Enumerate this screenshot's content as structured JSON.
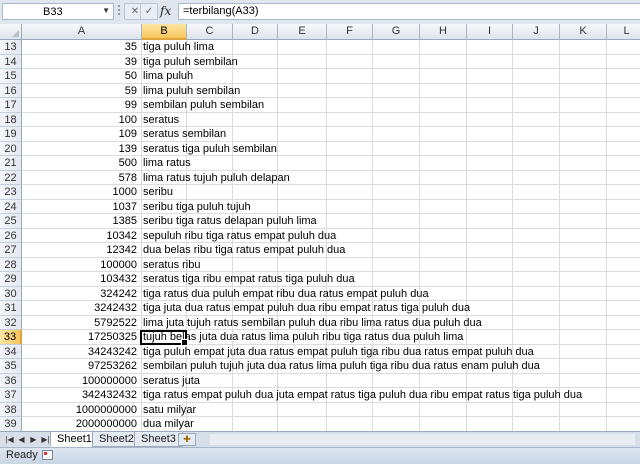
{
  "formula_bar": {
    "name_box": "B33",
    "cancel_icon": "✕",
    "enter_icon": "✓",
    "fx_label": "fx",
    "formula": "=terbilang(A33)"
  },
  "columns": [
    "A",
    "B",
    "C",
    "D",
    "E",
    "F",
    "G",
    "H",
    "I",
    "J",
    "K",
    "L"
  ],
  "selected_column": "B",
  "rows": [
    {
      "num": "13",
      "a": "35",
      "b": "tiga puluh lima"
    },
    {
      "num": "14",
      "a": "39",
      "b": "tiga puluh sembilan"
    },
    {
      "num": "15",
      "a": "50",
      "b": "lima puluh"
    },
    {
      "num": "16",
      "a": "59",
      "b": "lima puluh sembilan"
    },
    {
      "num": "17",
      "a": "99",
      "b": "sembilan puluh sembilan"
    },
    {
      "num": "18",
      "a": "100",
      "b": "seratus"
    },
    {
      "num": "19",
      "a": "109",
      "b": "seratus sembilan"
    },
    {
      "num": "20",
      "a": "139",
      "b": "seratus tiga puluh sembilan"
    },
    {
      "num": "21",
      "a": "500",
      "b": "lima ratus"
    },
    {
      "num": "22",
      "a": "578",
      "b": "lima ratus tujuh puluh delapan"
    },
    {
      "num": "23",
      "a": "1000",
      "b": "seribu"
    },
    {
      "num": "24",
      "a": "1037",
      "b": "seribu tiga puluh tujuh"
    },
    {
      "num": "25",
      "a": "1385",
      "b": "seribu tiga ratus delapan puluh lima"
    },
    {
      "num": "26",
      "a": "10342",
      "b": "sepuluh ribu tiga ratus empat puluh dua"
    },
    {
      "num": "27",
      "a": "12342",
      "b": "dua belas ribu tiga ratus empat puluh dua"
    },
    {
      "num": "28",
      "a": "100000",
      "b": "seratus ribu"
    },
    {
      "num": "29",
      "a": "103432",
      "b": "seratus tiga ribu empat ratus tiga puluh dua"
    },
    {
      "num": "30",
      "a": "324242",
      "b": "tiga ratus dua puluh empat ribu dua ratus empat puluh dua"
    },
    {
      "num": "31",
      "a": "3242432",
      "b": "tiga juta dua ratus empat puluh dua ribu empat ratus tiga puluh dua"
    },
    {
      "num": "32",
      "a": "5792522",
      "b": "lima juta tujuh ratus sembilan puluh dua ribu lima ratus dua puluh dua"
    },
    {
      "num": "33",
      "a": "17250325",
      "b": "tujuh belas juta dua ratus lima puluh ribu tiga ratus dua puluh lima"
    },
    {
      "num": "34",
      "a": "34243242",
      "b": "tiga puluh empat juta dua ratus empat puluh tiga ribu dua ratus empat puluh dua"
    },
    {
      "num": "35",
      "a": "97253262",
      "b": "sembilan puluh tujuh juta dua ratus lima puluh tiga ribu dua ratus enam puluh dua"
    },
    {
      "num": "36",
      "a": "100000000",
      "b": "seratus juta"
    },
    {
      "num": "37",
      "a": "342432432",
      "b": "tiga ratus empat puluh dua juta empat ratus tiga puluh dua ribu empat ratus tiga puluh dua"
    },
    {
      "num": "38",
      "a": "1000000000",
      "b": "satu milyar"
    },
    {
      "num": "39",
      "a": "2000000000",
      "b": "dua milyar"
    }
  ],
  "active_row": "33",
  "sheet_tabs": {
    "nav_icons": [
      "|◀",
      "◀",
      "▶",
      "▶|"
    ],
    "tabs": [
      "Sheet1",
      "Sheet2",
      "Sheet3"
    ],
    "active": "Sheet1",
    "new_sheet_icon": "insert-sheet-icon"
  },
  "status_bar": {
    "status": "Ready"
  }
}
